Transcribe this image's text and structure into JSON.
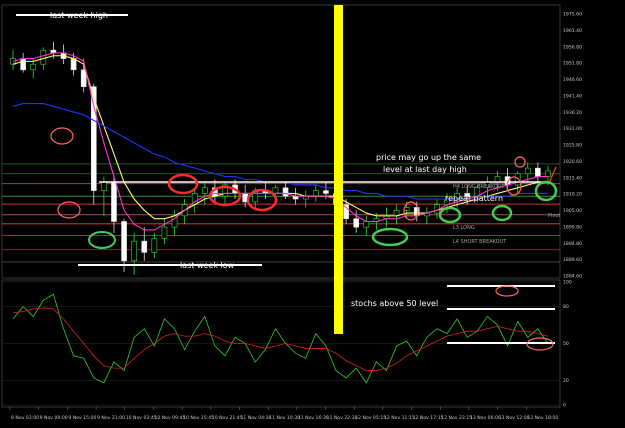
{
  "chart_data": {
    "type": "line",
    "panels": [
      "price",
      "stochastic"
    ],
    "price_axis": {
      "ylim": [
        1884.6,
        1980.0
      ],
      "ticks": [
        "1975.60",
        "1961.40",
        "1956.80",
        "1951.80",
        "1946.60",
        "1941.40",
        "1936.20",
        "1931.00",
        "1925.80",
        "1920.60",
        "1915.40",
        "1910.20",
        "1905.00",
        "1899.80",
        "1894.80",
        "1889.60",
        "1884.60"
      ]
    },
    "stoch_axis": {
      "ylim": [
        0,
        100
      ],
      "ticks": [
        "100",
        "80",
        "50",
        "20",
        "0"
      ]
    },
    "x_axis": {
      "ticks": [
        "8 Nov 03:00",
        "9 Nov 09:00",
        "9 Nov 15:00",
        "9 Nov 21:00",
        "10 Nov 03:45",
        "10 Nov 09:45",
        "10 Nov 15:45",
        "10 Nov 21:45",
        "11 Nov 04:30",
        "11 Nov 10:30",
        "11 Nov 16:30",
        "11 Nov 22:30",
        "12 Nov 05:15",
        "12 Nov 11:15",
        "12 Nov 17:15",
        "12 Nov 23:15",
        "13 Nov 06:00",
        "13 Nov 12:00",
        "13 Nov 18:00"
      ]
    },
    "level_labels": [
      "H4 LONG BREAKOUT",
      "L3 LONG",
      "L4 SHORT BREAKOUT",
      "Pivot"
    ],
    "annotations": {
      "last_week_high": "last week high",
      "last_week_low": "last week low",
      "price_note_1": "price may go up the same",
      "price_note_2": "level at last day high",
      "repeat": "repeat pattern",
      "stochs": "stochs above 50 level"
    },
    "candles": [
      [
        1960,
        1965,
        1958,
        1962
      ],
      [
        1962,
        1964,
        1957,
        1958
      ],
      [
        1958,
        1962,
        1955,
        1960
      ],
      [
        1960,
        1966,
        1958,
        1965
      ],
      [
        1965,
        1968,
        1962,
        1964
      ],
      [
        1964,
        1967,
        1960,
        1962
      ],
      [
        1962,
        1964,
        1956,
        1958
      ],
      [
        1958,
        1962,
        1950,
        1952
      ],
      [
        1952,
        1953,
        1910,
        1915
      ],
      [
        1915,
        1920,
        1906,
        1918
      ],
      [
        1918,
        1920,
        1900,
        1904
      ],
      [
        1904,
        1905,
        1886,
        1890
      ],
      [
        1890,
        1900,
        1885,
        1897
      ],
      [
        1897,
        1902,
        1890,
        1893
      ],
      [
        1893,
        1900,
        1891,
        1898
      ],
      [
        1898,
        1905,
        1896,
        1902
      ],
      [
        1902,
        1908,
        1899,
        1906
      ],
      [
        1906,
        1912,
        1903,
        1910
      ],
      [
        1910,
        1916,
        1907,
        1914
      ],
      [
        1914,
        1918,
        1910,
        1916
      ],
      [
        1916,
        1919,
        1911,
        1913
      ],
      [
        1913,
        1918,
        1910,
        1917
      ],
      [
        1917,
        1919,
        1912,
        1914
      ],
      [
        1914,
        1917,
        1909,
        1911
      ],
      [
        1911,
        1916,
        1908,
        1915
      ],
      [
        1915,
        1918,
        1912,
        1914
      ],
      [
        1914,
        1917,
        1911,
        1916
      ],
      [
        1916,
        1918,
        1912,
        1913
      ],
      [
        1913,
        1916,
        1910,
        1912
      ],
      [
        1912,
        1915,
        1909,
        1913
      ],
      [
        1913,
        1917,
        1911,
        1915
      ],
      [
        1915,
        1918,
        1912,
        1914
      ],
      [
        1914,
        1916,
        1909,
        1910
      ],
      [
        1910,
        1912,
        1903,
        1905
      ],
      [
        1905,
        1908,
        1900,
        1902
      ],
      [
        1902,
        1906,
        1899,
        1904
      ],
      [
        1904,
        1907,
        1901,
        1905
      ],
      [
        1905,
        1909,
        1902,
        1906
      ],
      [
        1906,
        1910,
        1903,
        1908
      ],
      [
        1908,
        1911,
        1905,
        1909
      ],
      [
        1909,
        1911,
        1904,
        1906
      ],
      [
        1906,
        1909,
        1903,
        1907
      ],
      [
        1907,
        1912,
        1905,
        1910
      ],
      [
        1910,
        1914,
        1907,
        1912
      ],
      [
        1912,
        1916,
        1909,
        1914
      ],
      [
        1914,
        1917,
        1910,
        1913
      ],
      [
        1913,
        1917,
        1911,
        1916
      ],
      [
        1916,
        1920,
        1913,
        1918
      ],
      [
        1918,
        1922,
        1915,
        1920
      ],
      [
        1920,
        1923,
        1916,
        1917
      ],
      [
        1917,
        1922,
        1914,
        1921
      ],
      [
        1921,
        1925,
        1918,
        1923
      ],
      [
        1923,
        1925,
        1918,
        1920
      ],
      [
        1920,
        1924,
        1917,
        1922
      ]
    ],
    "series": [
      {
        "name": "",
        "color": "#ffff66",
        "values": [
          1960,
          1961,
          1961,
          1962,
          1963,
          1963,
          1962,
          1960,
          1948,
          1938,
          1928,
          1918,
          1912,
          1908,
          1905,
          1905,
          1906,
          1908,
          1910,
          1912,
          1913,
          1914,
          1914,
          1914,
          1914,
          1914,
          1914,
          1914,
          1914,
          1913,
          1913,
          1913,
          1913,
          1911,
          1909,
          1907,
          1906,
          1906,
          1906,
          1907,
          1907,
          1907,
          1908,
          1909,
          1910,
          1911,
          1912,
          1913,
          1914,
          1915,
          1916,
          1917,
          1918,
          1918
        ]
      },
      {
        "name": "",
        "color": "#ff33cc",
        "values": [
          1961,
          1962,
          1962,
          1963,
          1964,
          1964,
          1963,
          1961,
          1945,
          1932,
          1920,
          1908,
          1903,
          1901,
          1901,
          1903,
          1905,
          1908,
          1911,
          1913,
          1914,
          1914,
          1914,
          1914,
          1914,
          1914,
          1914,
          1914,
          1913,
          1913,
          1913,
          1913,
          1912,
          1909,
          1906,
          1904,
          1904,
          1905,
          1905,
          1906,
          1906,
          1907,
          1908,
          1910,
          1911,
          1912,
          1913,
          1915,
          1916,
          1917,
          1918,
          1919,
          1920,
          1920
        ]
      },
      {
        "name": "",
        "color": "#2233ff",
        "values": [
          1945,
          1946,
          1946,
          1946,
          1945,
          1944,
          1943,
          1942,
          1940,
          1938,
          1936,
          1934,
          1932,
          1930,
          1928,
          1927,
          1925,
          1924,
          1923,
          1922,
          1921,
          1920,
          1920,
          1919,
          1919,
          1918,
          1918,
          1918,
          1917,
          1917,
          1917,
          1916,
          1916,
          1915,
          1915,
          1914,
          1914,
          1913,
          1913,
          1913,
          1912,
          1912,
          1912,
          1912,
          1912,
          1912,
          1912,
          1913,
          1913,
          1913,
          1914,
          1914,
          1914,
          1914
        ]
      }
    ],
    "stoch_series": [
      {
        "name": "",
        "color": "#33cc33",
        "values": [
          70,
          80,
          72,
          85,
          90,
          62,
          40,
          38,
          22,
          18,
          35,
          28,
          55,
          62,
          48,
          70,
          62,
          45,
          60,
          72,
          48,
          40,
          55,
          50,
          35,
          45,
          62,
          50,
          42,
          38,
          58,
          48,
          28,
          22,
          30,
          18,
          35,
          28,
          48,
          52,
          40,
          55,
          62,
          58,
          70,
          55,
          60,
          72,
          65,
          48,
          68,
          55,
          62,
          50
        ]
      },
      {
        "name": "",
        "color": "#dd2222",
        "values": [
          75,
          76,
          78,
          79,
          78,
          70,
          60,
          50,
          40,
          32,
          30,
          30,
          38,
          45,
          50,
          56,
          58,
          56,
          56,
          58,
          56,
          52,
          50,
          50,
          48,
          46,
          48,
          50,
          48,
          46,
          46,
          46,
          42,
          36,
          32,
          28,
          28,
          30,
          34,
          40,
          44,
          48,
          52,
          56,
          58,
          60,
          60,
          62,
          64,
          62,
          60,
          60,
          58,
          56
        ]
      }
    ]
  }
}
